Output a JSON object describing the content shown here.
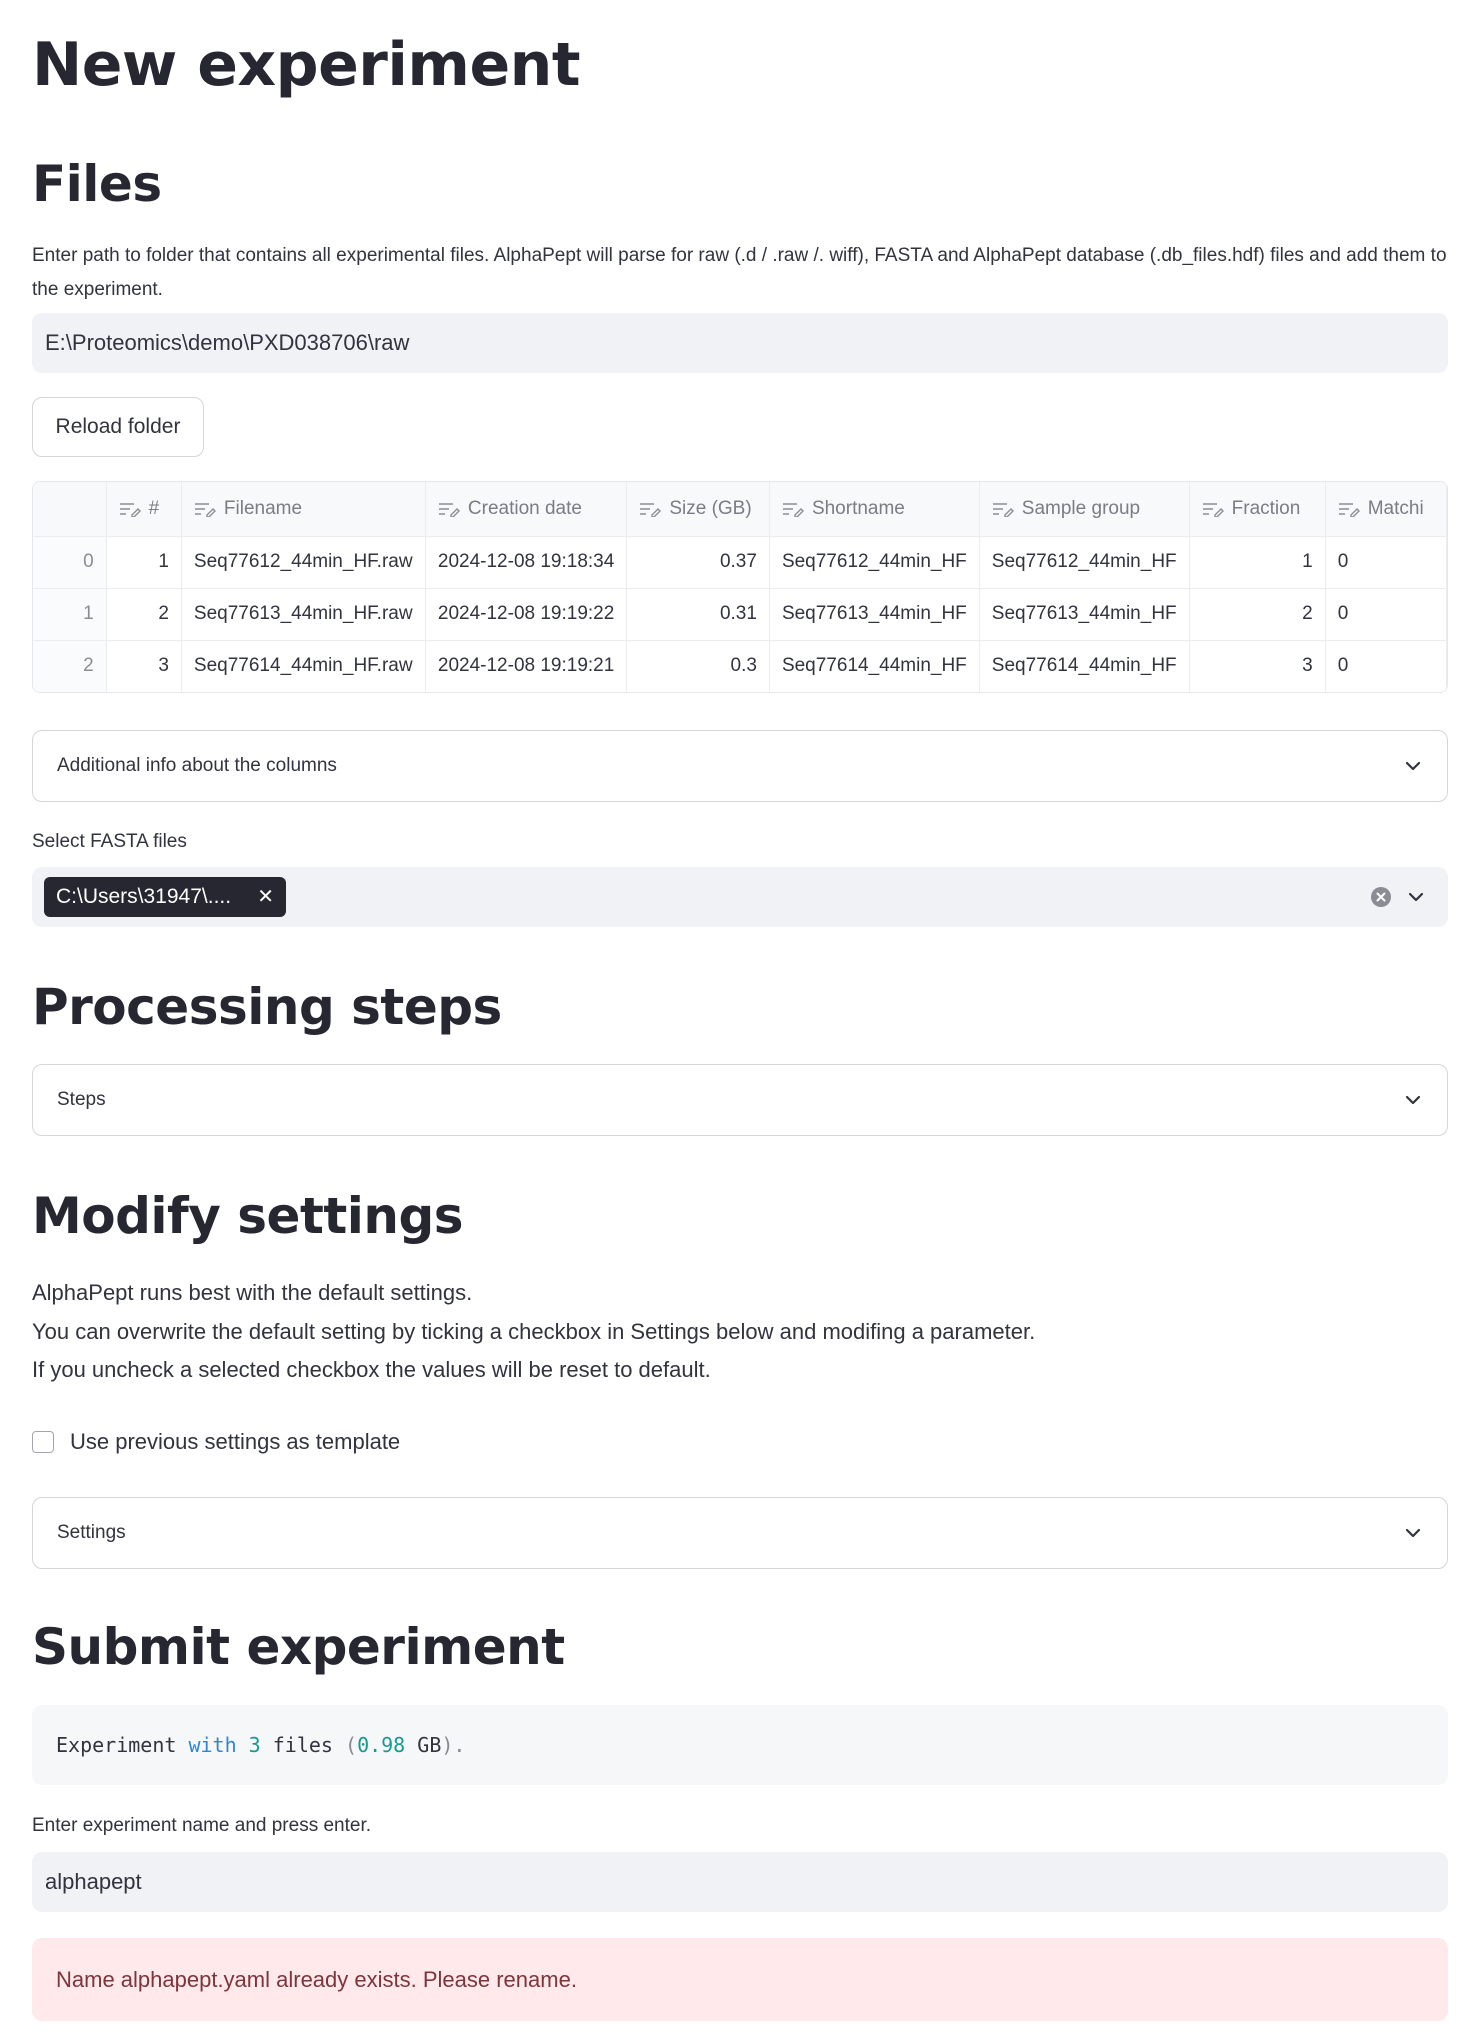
{
  "page_title": "New experiment",
  "files": {
    "heading": "Files",
    "description": "Enter path to folder that contains all experimental files. AlphaPept will parse for raw (.d / .raw /. wiff), FASTA and AlphaPept database (.db_files.hdf) files and add them to the experiment.",
    "folder_path": "E:\\Proteomics\\demo\\PXD038706\\raw",
    "reload_label": "Reload folder",
    "table": {
      "columns": [
        "",
        "#",
        "Filename",
        "Creation date",
        "Size (GB)",
        "Shortname",
        "Sample group",
        "Fraction",
        "Matchi"
      ],
      "rows": [
        [
          "0",
          "1",
          "Seq77612_44min_HF.raw",
          "2024-12-08 19:18:34",
          "0.37",
          "Seq77612_44min_HF",
          "Seq77612_44min_HF",
          "1",
          "0"
        ],
        [
          "1",
          "2",
          "Seq77613_44min_HF.raw",
          "2024-12-08 19:19:22",
          "0.31",
          "Seq77613_44min_HF",
          "Seq77613_44min_HF",
          "2",
          "0"
        ],
        [
          "2",
          "3",
          "Seq77614_44min_HF.raw",
          "2024-12-08 19:19:21",
          "0.3",
          "Seq77614_44min_HF",
          "Seq77614_44min_HF",
          "3",
          "0"
        ]
      ]
    },
    "columns_info_label": "Additional info about the columns",
    "fasta_label": "Select FASTA files",
    "fasta_selected": "C:\\Users\\31947\\...."
  },
  "processing": {
    "heading": "Processing steps",
    "steps_label": "Steps"
  },
  "modify": {
    "heading": "Modify settings",
    "lines": [
      "AlphaPept runs best with the default settings.",
      "You can overwrite the default setting by ticking a checkbox in Settings below and modifing a parameter.",
      "If you uncheck a selected checkbox the values will be reset to default."
    ],
    "template_checkbox_label": "Use previous settings as template",
    "template_checked": false,
    "settings_label": "Settings"
  },
  "submit": {
    "heading": "Submit experiment",
    "code": {
      "part1": "Experiment ",
      "kw_with": "with",
      "part2": " ",
      "num_files": "3",
      "part3": " files ",
      "paren_open": "(",
      "size": "0.98",
      "part4": " GB",
      "paren_close": ")."
    },
    "name_label": "Enter experiment name and press enter.",
    "name_value": "alphapept",
    "error": "Name alphapept.yaml already exists. Please rename."
  },
  "colors": {
    "text": "#31333f",
    "input_bg": "#f0f2f6",
    "chip_bg": "#262730",
    "error_bg": "#ffe9ea",
    "error_text": "#7d353b",
    "code_keyword": "#2f86d1",
    "code_number": "#169a8f"
  },
  "icons": {
    "column_header": "column-menu-icon",
    "expander": "chevron-down-icon",
    "clear": "clear-circle-icon",
    "chip_remove": "close-icon"
  }
}
